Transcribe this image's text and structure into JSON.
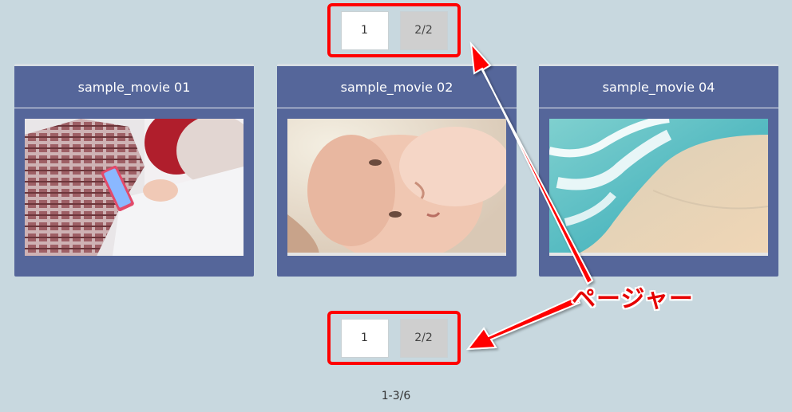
{
  "pager_top": {
    "current_label": "1",
    "other_label": "2/2"
  },
  "pager_bottom": {
    "current_label": "1",
    "other_label": "2/2"
  },
  "cards": [
    {
      "title": "sample_movie 01"
    },
    {
      "title": "sample_movie 02"
    },
    {
      "title": "sample_movie 04"
    }
  ],
  "annotation": {
    "label": "ページャー",
    "color": "#e60000"
  },
  "result_count": "1-3/6",
  "colors": {
    "background": "#c8d8df",
    "card": "#55669a",
    "highlight_border": "#ff0000"
  }
}
